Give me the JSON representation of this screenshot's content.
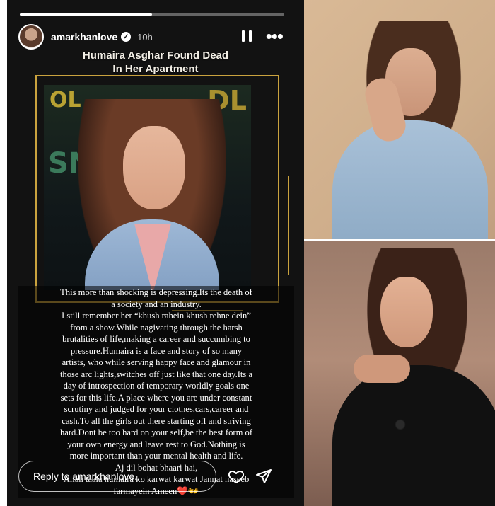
{
  "story": {
    "progress_fraction": 0.5,
    "username": "amarkhanlove",
    "verified_glyph": "✓",
    "timestamp": "10h",
    "icons": {
      "pause": "pause-icon",
      "more": "more-icon",
      "heart": "heart-icon",
      "send": "send-icon"
    },
    "more_glyph": "•••",
    "post_title_line1": "Humaira Asghar Found Dead",
    "post_title_line2": "In Her Apartment",
    "backdrop_text": [
      "OL",
      "SN",
      "DL"
    ],
    "caption_lines": [
      "This more than shocking is depressing.Its the death of",
      "a society and an industry.",
      "I still remember her “khush rahein khush rehne dein”",
      "from a show.While nagivating through the harsh",
      "brutalities of life,making a career and succumbing to",
      "pressure.Humaira is a face and story of so many",
      "artists, who while serving happy face and glamour in",
      "those arc lights,switches off just like that one day.Its a",
      "day of introspection of temporary worldly goals one",
      "sets for this life.A place where you are under constant",
      "scrutiny and judged for your clothes,cars,career and",
      "cash.To all the girls out there starting off and striving",
      "hard.Dont be too hard on your self,be the best form of",
      "your own energy and leave rest to God.Nothing is",
      "more important than your mental health and life.",
      "Aj dil bohat bhaari hai,",
      "Allah taala humaira ko karwat karwat Jannat naseeb",
      "farmayein Ameen❤️👐"
    ],
    "reply_placeholder": "Reply to amarkhanlove..."
  },
  "colors": {
    "story_bg": "#121212",
    "frame_gold": "#c9a23e"
  }
}
